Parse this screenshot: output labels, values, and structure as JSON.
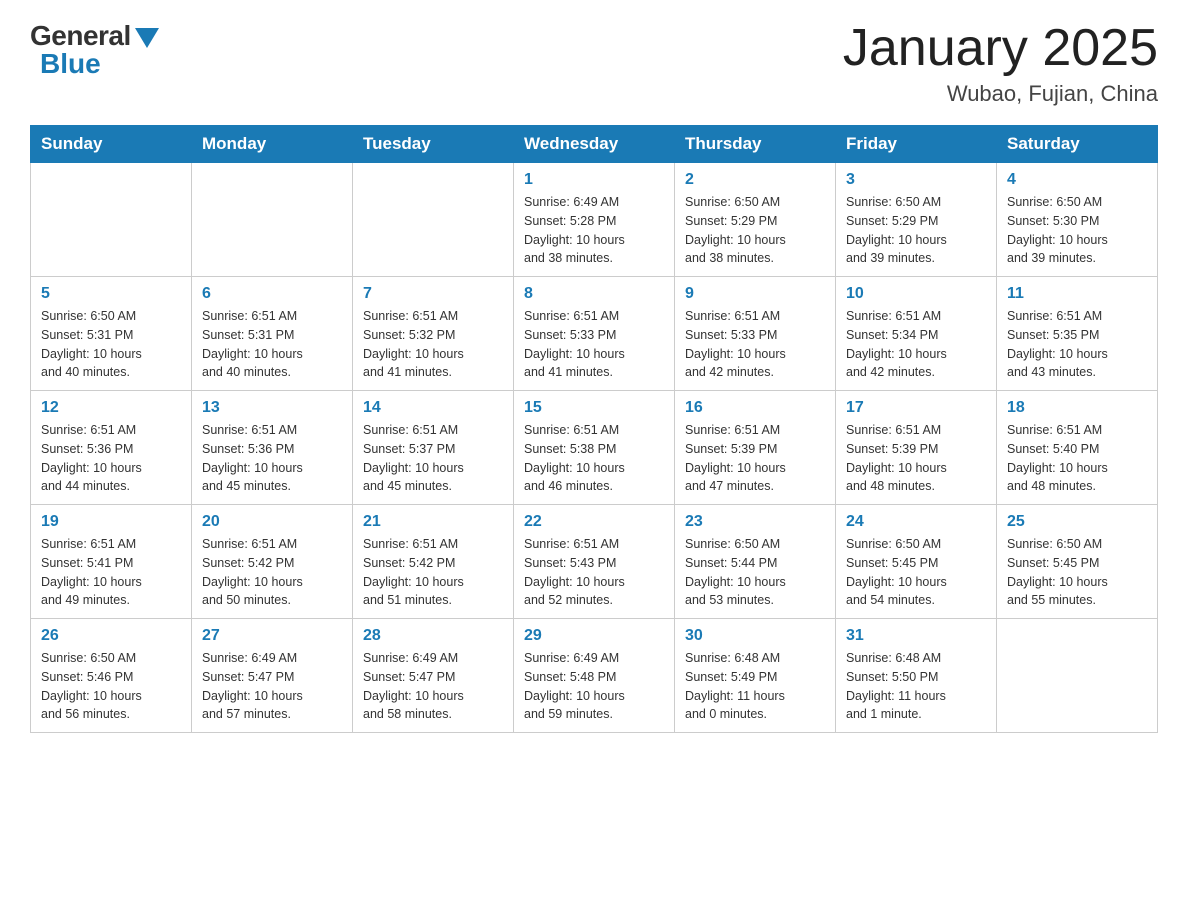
{
  "header": {
    "logo_general": "General",
    "logo_blue": "Blue",
    "title": "January 2025",
    "location": "Wubao, Fujian, China"
  },
  "days_of_week": [
    "Sunday",
    "Monday",
    "Tuesday",
    "Wednesday",
    "Thursday",
    "Friday",
    "Saturday"
  ],
  "weeks": [
    [
      {
        "day": "",
        "info": ""
      },
      {
        "day": "",
        "info": ""
      },
      {
        "day": "",
        "info": ""
      },
      {
        "day": "1",
        "info": "Sunrise: 6:49 AM\nSunset: 5:28 PM\nDaylight: 10 hours\nand 38 minutes."
      },
      {
        "day": "2",
        "info": "Sunrise: 6:50 AM\nSunset: 5:29 PM\nDaylight: 10 hours\nand 38 minutes."
      },
      {
        "day": "3",
        "info": "Sunrise: 6:50 AM\nSunset: 5:29 PM\nDaylight: 10 hours\nand 39 minutes."
      },
      {
        "day": "4",
        "info": "Sunrise: 6:50 AM\nSunset: 5:30 PM\nDaylight: 10 hours\nand 39 minutes."
      }
    ],
    [
      {
        "day": "5",
        "info": "Sunrise: 6:50 AM\nSunset: 5:31 PM\nDaylight: 10 hours\nand 40 minutes."
      },
      {
        "day": "6",
        "info": "Sunrise: 6:51 AM\nSunset: 5:31 PM\nDaylight: 10 hours\nand 40 minutes."
      },
      {
        "day": "7",
        "info": "Sunrise: 6:51 AM\nSunset: 5:32 PM\nDaylight: 10 hours\nand 41 minutes."
      },
      {
        "day": "8",
        "info": "Sunrise: 6:51 AM\nSunset: 5:33 PM\nDaylight: 10 hours\nand 41 minutes."
      },
      {
        "day": "9",
        "info": "Sunrise: 6:51 AM\nSunset: 5:33 PM\nDaylight: 10 hours\nand 42 minutes."
      },
      {
        "day": "10",
        "info": "Sunrise: 6:51 AM\nSunset: 5:34 PM\nDaylight: 10 hours\nand 42 minutes."
      },
      {
        "day": "11",
        "info": "Sunrise: 6:51 AM\nSunset: 5:35 PM\nDaylight: 10 hours\nand 43 minutes."
      }
    ],
    [
      {
        "day": "12",
        "info": "Sunrise: 6:51 AM\nSunset: 5:36 PM\nDaylight: 10 hours\nand 44 minutes."
      },
      {
        "day": "13",
        "info": "Sunrise: 6:51 AM\nSunset: 5:36 PM\nDaylight: 10 hours\nand 45 minutes."
      },
      {
        "day": "14",
        "info": "Sunrise: 6:51 AM\nSunset: 5:37 PM\nDaylight: 10 hours\nand 45 minutes."
      },
      {
        "day": "15",
        "info": "Sunrise: 6:51 AM\nSunset: 5:38 PM\nDaylight: 10 hours\nand 46 minutes."
      },
      {
        "day": "16",
        "info": "Sunrise: 6:51 AM\nSunset: 5:39 PM\nDaylight: 10 hours\nand 47 minutes."
      },
      {
        "day": "17",
        "info": "Sunrise: 6:51 AM\nSunset: 5:39 PM\nDaylight: 10 hours\nand 48 minutes."
      },
      {
        "day": "18",
        "info": "Sunrise: 6:51 AM\nSunset: 5:40 PM\nDaylight: 10 hours\nand 48 minutes."
      }
    ],
    [
      {
        "day": "19",
        "info": "Sunrise: 6:51 AM\nSunset: 5:41 PM\nDaylight: 10 hours\nand 49 minutes."
      },
      {
        "day": "20",
        "info": "Sunrise: 6:51 AM\nSunset: 5:42 PM\nDaylight: 10 hours\nand 50 minutes."
      },
      {
        "day": "21",
        "info": "Sunrise: 6:51 AM\nSunset: 5:42 PM\nDaylight: 10 hours\nand 51 minutes."
      },
      {
        "day": "22",
        "info": "Sunrise: 6:51 AM\nSunset: 5:43 PM\nDaylight: 10 hours\nand 52 minutes."
      },
      {
        "day": "23",
        "info": "Sunrise: 6:50 AM\nSunset: 5:44 PM\nDaylight: 10 hours\nand 53 minutes."
      },
      {
        "day": "24",
        "info": "Sunrise: 6:50 AM\nSunset: 5:45 PM\nDaylight: 10 hours\nand 54 minutes."
      },
      {
        "day": "25",
        "info": "Sunrise: 6:50 AM\nSunset: 5:45 PM\nDaylight: 10 hours\nand 55 minutes."
      }
    ],
    [
      {
        "day": "26",
        "info": "Sunrise: 6:50 AM\nSunset: 5:46 PM\nDaylight: 10 hours\nand 56 minutes."
      },
      {
        "day": "27",
        "info": "Sunrise: 6:49 AM\nSunset: 5:47 PM\nDaylight: 10 hours\nand 57 minutes."
      },
      {
        "day": "28",
        "info": "Sunrise: 6:49 AM\nSunset: 5:47 PM\nDaylight: 10 hours\nand 58 minutes."
      },
      {
        "day": "29",
        "info": "Sunrise: 6:49 AM\nSunset: 5:48 PM\nDaylight: 10 hours\nand 59 minutes."
      },
      {
        "day": "30",
        "info": "Sunrise: 6:48 AM\nSunset: 5:49 PM\nDaylight: 11 hours\nand 0 minutes."
      },
      {
        "day": "31",
        "info": "Sunrise: 6:48 AM\nSunset: 5:50 PM\nDaylight: 11 hours\nand 1 minute."
      },
      {
        "day": "",
        "info": ""
      }
    ]
  ]
}
